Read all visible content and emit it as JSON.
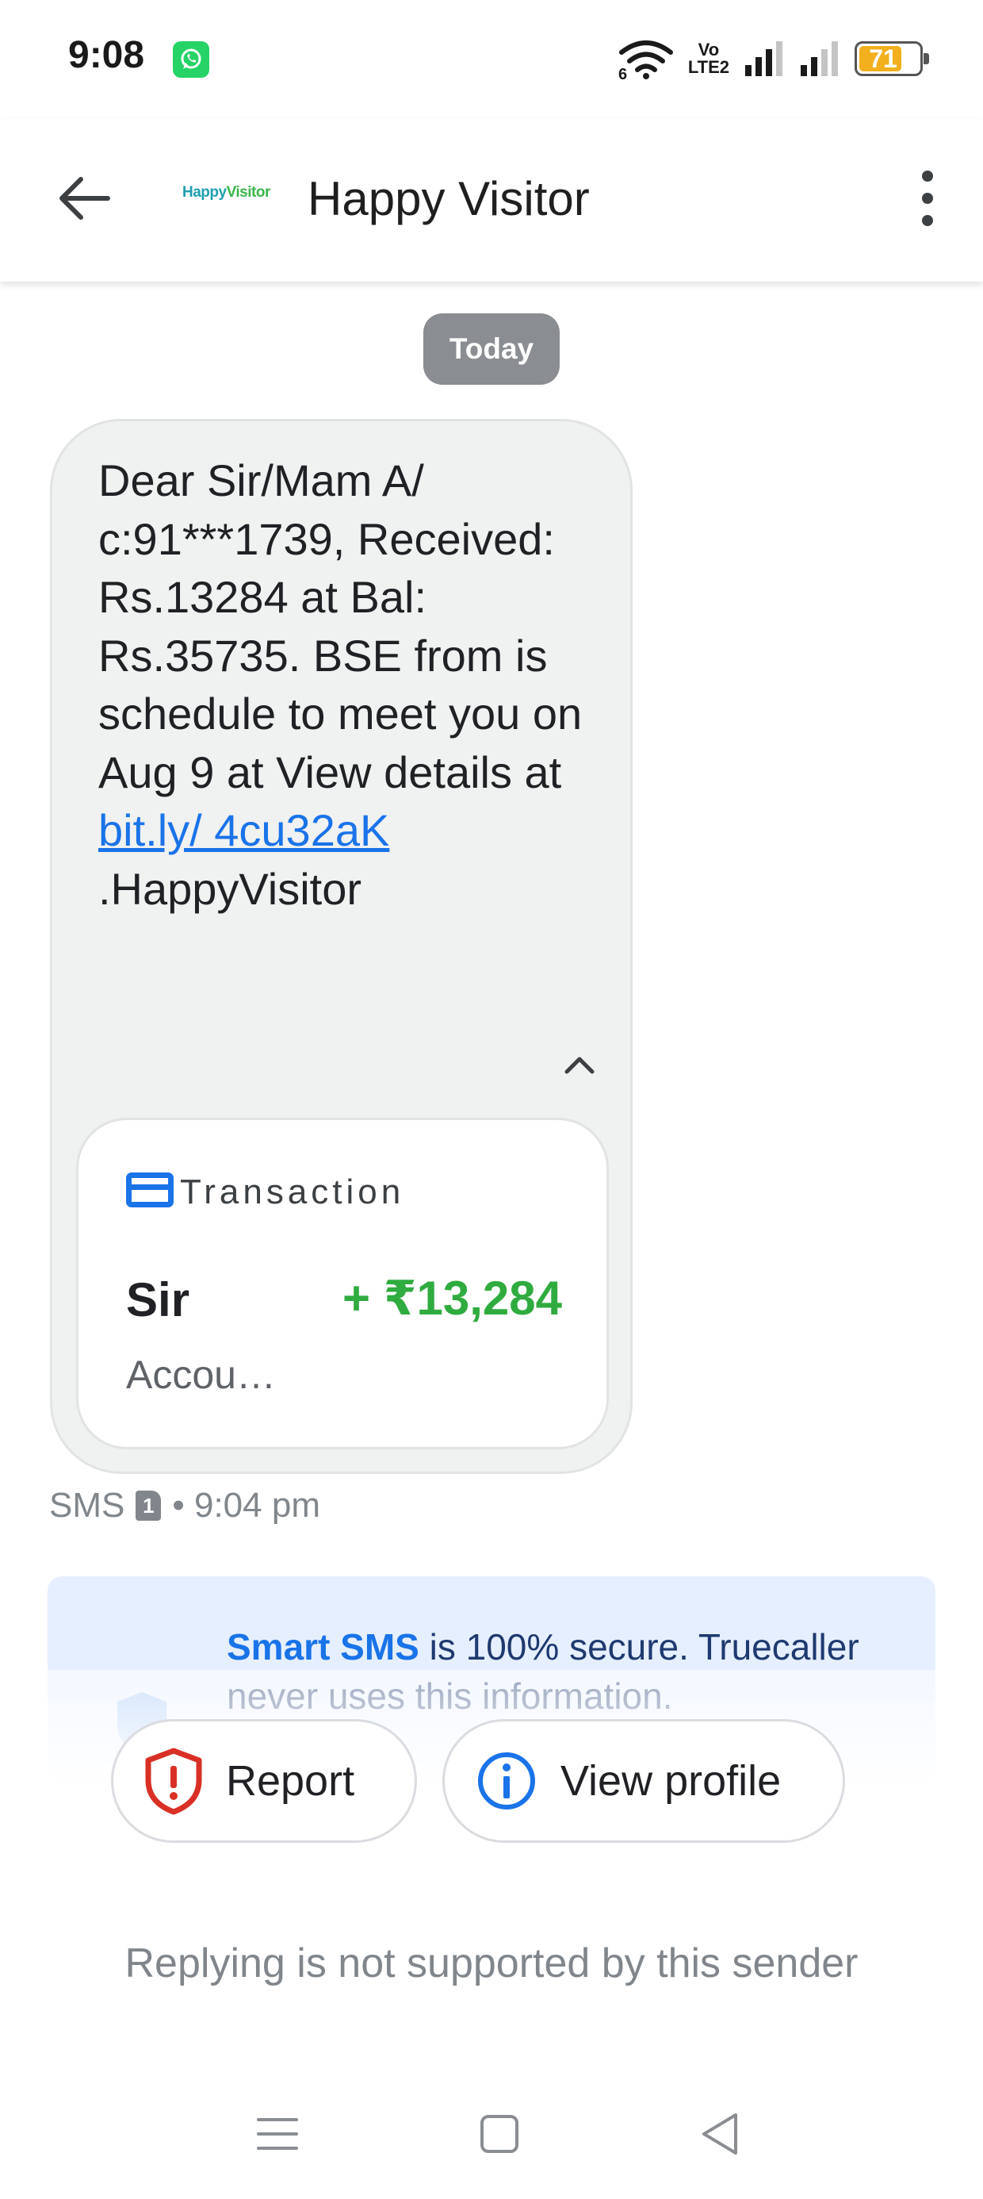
{
  "status_bar": {
    "time": "9:08",
    "network_label_top": "Vo",
    "network_label_bottom": "LTE2",
    "wifi_sub": "6",
    "battery_level": "71",
    "battery_color": "#f2b01e"
  },
  "app_bar": {
    "title": "Happy Visitor",
    "logo_text_main": "Happy",
    "logo_text_accent": "Visitor",
    "back_icon": "arrow-back-icon",
    "more_icon": "more-vert-icon"
  },
  "conversation": {
    "date_chip": "Today",
    "message": {
      "text_before_link": "Dear Sir/Mam A/ c:91***1739, Received: Rs.13284 at Bal: Rs.35735. BSE from is schedule to meet you on Aug 9 at View details at ",
      "link_text": "bit.ly/ 4cu32aK",
      "text_after_link": " .HappyVisitor",
      "collapse_icon": "chevron-up-icon"
    },
    "transaction_card": {
      "label": "Transaction",
      "name": "Sir",
      "amount": "+ ₹13,284",
      "sub": "Accou…",
      "amount_color": "#2fab3f"
    },
    "meta": {
      "channel": "SMS",
      "sim": "1",
      "time": "• 9:04 pm"
    },
    "secure_notice": {
      "strong": "Smart SMS",
      "rest": " is 100% secure. Truecaller never uses this information."
    },
    "actions": {
      "report_label": "Report",
      "view_profile_label": "View profile"
    },
    "reply_note": "Replying is not supported by this sender"
  },
  "nav_bar": {
    "menu_icon": "menu-icon",
    "home_icon": "home-square-icon",
    "back_icon": "back-triangle-icon"
  }
}
